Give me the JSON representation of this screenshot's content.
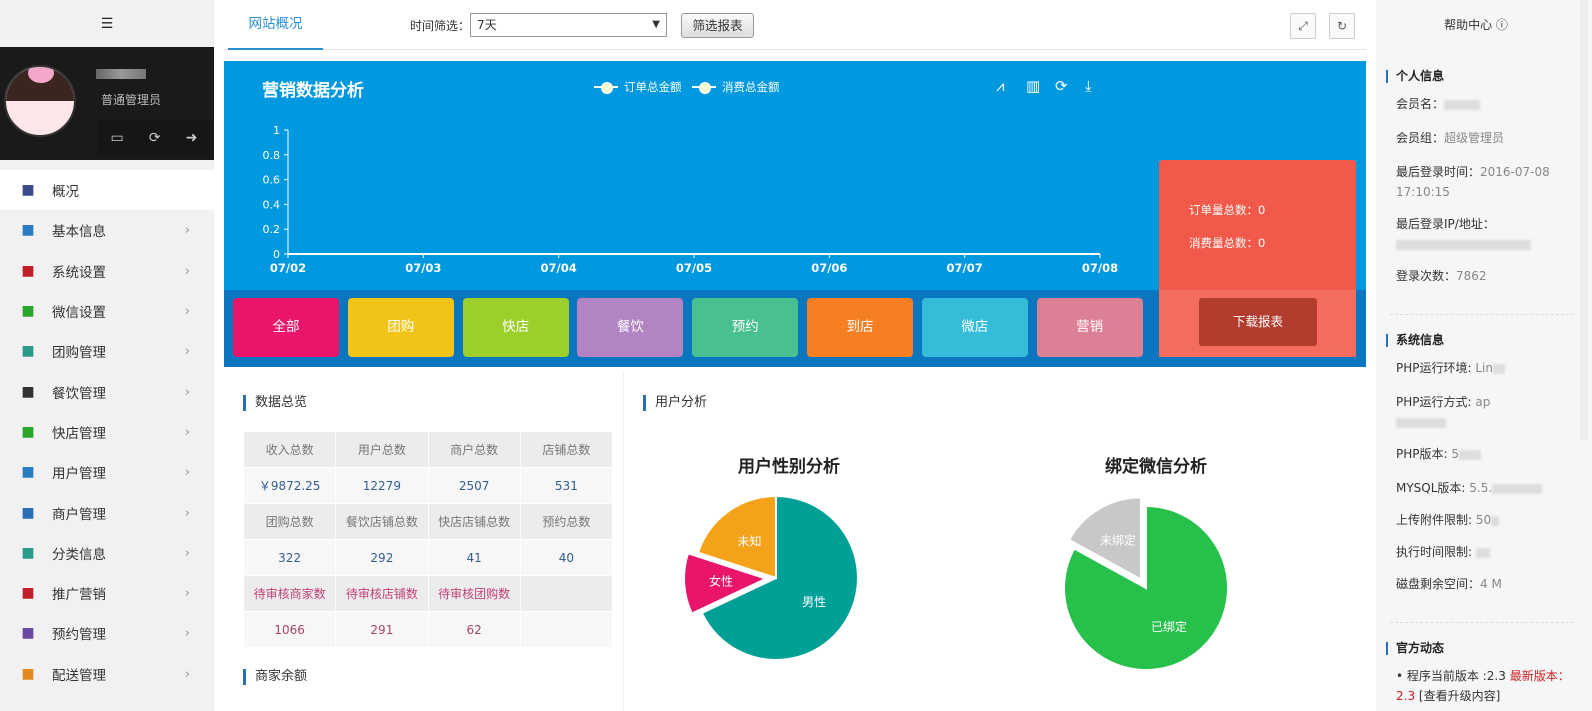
{
  "sidebar": {
    "user_role": "普通管理员",
    "items": [
      {
        "label": "概况",
        "icon": "line-chart-icon",
        "color": "#3a4a8a"
      },
      {
        "label": "基本信息",
        "icon": "server-icon",
        "color": "#2a7bbf"
      },
      {
        "label": "系统设置",
        "icon": "gear-icon",
        "color": "#c0202a"
      },
      {
        "label": "微信设置",
        "icon": "wechat-icon",
        "color": "#2aa52a"
      },
      {
        "label": "团购管理",
        "icon": "globe-icon",
        "color": "#2a9a8a"
      },
      {
        "label": "餐饮管理",
        "icon": "spoon-icon",
        "color": "#333"
      },
      {
        "label": "快店管理",
        "icon": "basket-icon",
        "color": "#2aa52a"
      },
      {
        "label": "用户管理",
        "icon": "user-icon",
        "color": "#2a7bbf"
      },
      {
        "label": "商户管理",
        "icon": "cloud-icon",
        "color": "#2a6eb6"
      },
      {
        "label": "分类信息",
        "icon": "list-icon",
        "color": "#2a9a8a"
      },
      {
        "label": "推广营销",
        "icon": "magic-wand-icon",
        "color": "#c0202a"
      },
      {
        "label": "预约管理",
        "icon": "bicycle-icon",
        "color": "#6a4aa0"
      },
      {
        "label": "配送管理",
        "icon": "truck-icon",
        "color": "#e08a20"
      }
    ]
  },
  "header": {
    "tab": "网站概况",
    "filter_label": "时间筛选：",
    "filter_value": "7天",
    "filter_button": "筛选报表"
  },
  "chart": {
    "title": "营销数据分析",
    "download_button": "下载报表",
    "order_total_label": "订单量总数：0",
    "consume_total_label": "消费量总数：0"
  },
  "chart_data": [
    {
      "type": "line",
      "title": "营销数据分析",
      "x": [
        "07/02",
        "07/03",
        "07/04",
        "07/05",
        "07/06",
        "07/07",
        "07/08"
      ],
      "yticks": [
        "1",
        "0.8",
        "0.6",
        "0.4",
        "0.2",
        "0"
      ],
      "ylim": [
        0,
        1
      ],
      "legend": "top",
      "series": [
        {
          "name": "订单总金额",
          "values": [
            0,
            0,
            0,
            0,
            0,
            0,
            0
          ]
        },
        {
          "name": "消费总金额",
          "values": [
            0,
            0,
            0,
            0,
            0,
            0,
            0
          ]
        }
      ]
    },
    {
      "type": "pie",
      "title": "用户性别分析",
      "labels": [
        "男性",
        "女性",
        "未知"
      ],
      "values": [
        68,
        12,
        20
      ],
      "colors": [
        "#00a096",
        "#e8156a",
        "#f5a21b"
      ]
    },
    {
      "type": "pie",
      "title": "绑定微信分析",
      "labels": [
        "已绑定",
        "未绑定"
      ],
      "values": [
        83,
        17
      ],
      "colors": [
        "#26c04a",
        "#c8c8c8"
      ]
    }
  ],
  "tiles": [
    {
      "label": "全部",
      "color": "#e8156a"
    },
    {
      "label": "团购",
      "color": "#f2c418"
    },
    {
      "label": "快店",
      "color": "#9dcf2a"
    },
    {
      "label": "餐饮",
      "color": "#b284c4"
    },
    {
      "label": "预约",
      "color": "#48c08f"
    },
    {
      "label": "到店",
      "color": "#f57f22"
    },
    {
      "label": "微店",
      "color": "#35bcd8"
    },
    {
      "label": "营销",
      "color": "#dc8096"
    }
  ],
  "overview": {
    "title": "数据总览",
    "rows": [
      [
        "收入总数",
        "用户总数",
        "商户总数",
        "店铺总数"
      ],
      [
        "￥9872.25",
        "12279",
        "2507",
        "531"
      ],
      [
        "团购总数",
        "餐饮店铺总数",
        "快店店铺总数",
        "预约总数"
      ],
      [
        "322",
        "292",
        "41",
        "40"
      ],
      [
        "待审核商家数",
        "待审核店铺数",
        "待审核团购数",
        ""
      ],
      [
        "1066",
        "291",
        "62",
        ""
      ]
    ]
  },
  "balance_title": "商家余额",
  "user_analysis_title": "用户分析",
  "right": {
    "help": "帮助中心",
    "personal_title": "个人信息",
    "member_name": "会员名：",
    "member_group": "会员组：",
    "member_group_val": "超级管理员",
    "last_login_time": "最后登录时间：",
    "last_login_time_val": "2016-07-08 17:10:15",
    "last_ip": "最后登录IP/地址：",
    "login_count": "登录次数：",
    "login_count_val": "7862",
    "sys_title": "系统信息",
    "php_env": "PHP运行环境: ",
    "php_env_val": "Lin",
    "php_mode": "PHP运行方式: ",
    "php_mode_val": "ap",
    "php_ver": "PHP版本: ",
    "php_ver_val": "5",
    "mysql_ver": "MYSQL版本: ",
    "mysql_ver_val": "5.5.",
    "upload_limit": "上传附件限制: ",
    "upload_limit_val": "50",
    "exec_limit": "执行时间限制: ",
    "disk": "磁盘剩余空间：",
    "disk_val": "4   M",
    "news_title": "官方动态",
    "cur_ver": "程序当前版本 :2.3",
    "latest_ver": "最新版本：2.3",
    "upgrade_link": "[查看升级内容]"
  }
}
